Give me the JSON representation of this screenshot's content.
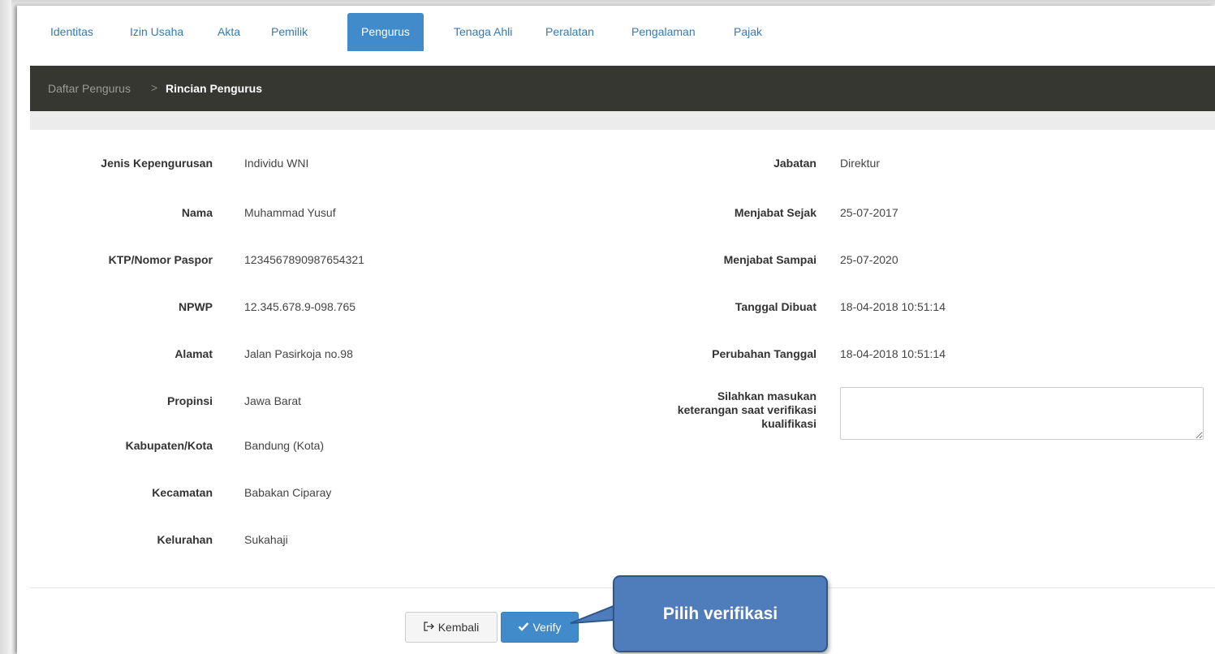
{
  "tabs": [
    {
      "label": "Identitas"
    },
    {
      "label": "Izin Usaha"
    },
    {
      "label": "Akta"
    },
    {
      "label": "Pemilik"
    },
    {
      "label": "Pengurus",
      "active": true
    },
    {
      "label": "Tenaga Ahli"
    },
    {
      "label": "Peralatan"
    },
    {
      "label": "Pengalaman"
    },
    {
      "label": "Pajak"
    }
  ],
  "breadcrumb": {
    "parent": "Daftar Pengurus",
    "separator": ">",
    "current": "Rincian Pengurus"
  },
  "left_fields": [
    {
      "label": "Jenis Kepengurusan",
      "value": "Individu WNI"
    },
    {
      "label": "Nama",
      "value": "Muhammad Yusuf"
    },
    {
      "label": "KTP/Nomor Paspor",
      "value": "123456789098765432​1"
    },
    {
      "label": "NPWP",
      "value": "12.345.678.9-098.765"
    },
    {
      "label": "Alamat",
      "value": "Jalan Pasirkoja no.98"
    },
    {
      "label": "Propinsi",
      "value": "Jawa Barat"
    },
    {
      "label": "Kabupaten/Kota",
      "value": "Bandung (Kota)"
    },
    {
      "label": "Kecamatan",
      "value": "Babakan Ciparay"
    },
    {
      "label": "Kelurahan",
      "value": "Sukahaji"
    }
  ],
  "right_fields": [
    {
      "label": "Jabatan",
      "value": "Direktur"
    },
    {
      "label": "Menjabat Sejak",
      "value": "25-07-2017"
    },
    {
      "label": "Menjabat Sampai",
      "value": "25-07-2020"
    },
    {
      "label": "Tanggal Dibuat",
      "value": "18-04-2018 10:51:14"
    },
    {
      "label": "Perubahan Tanggal",
      "value": "18-04-2018 10:51:14"
    }
  ],
  "keterangan": {
    "label_line1": "Silahkan masukan",
    "label_line2": "keterangan saat verifikasi",
    "label_line3": "kualifikasi",
    "value": ""
  },
  "buttons": {
    "back_label": "Kembali",
    "back_icon": "sign-out-icon",
    "verify_label": "Verify",
    "verify_icon": "check-icon"
  },
  "callout": {
    "text": "Pilih verifikasi"
  },
  "colors": {
    "accent": "#428bca",
    "breadcrumb_bg": "#373732",
    "callout": "#4f7dbb"
  }
}
